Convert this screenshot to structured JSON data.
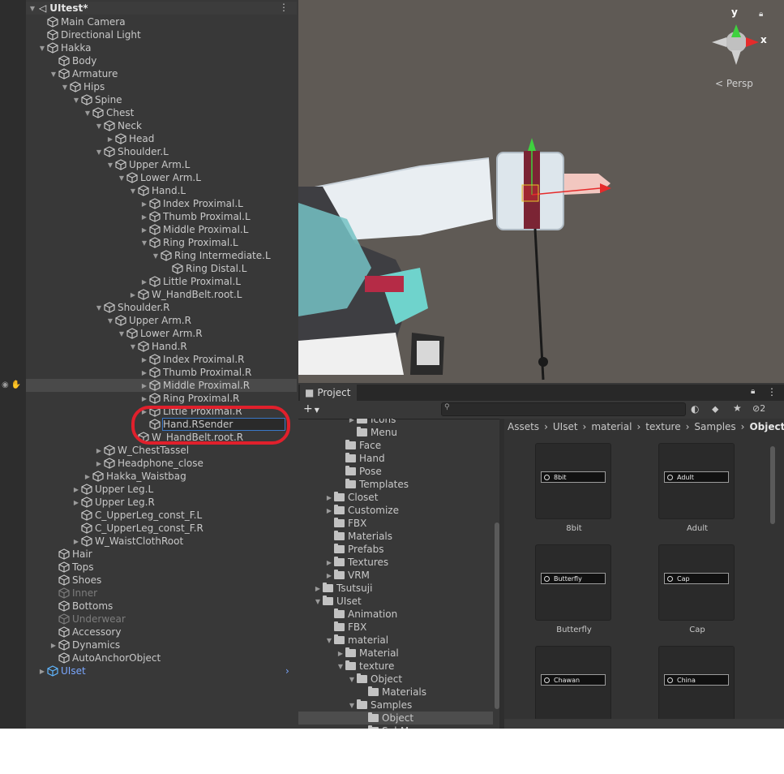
{
  "hierarchy": {
    "scene_title": "UItest*",
    "rows": [
      {
        "label": "Main Camera",
        "indent": 0,
        "arrow": "",
        "style": "normal"
      },
      {
        "label": "Directional Light",
        "indent": 0,
        "arrow": "",
        "style": "normal"
      },
      {
        "label": "Hakka",
        "indent": 0,
        "arrow": "down",
        "style": "normal"
      },
      {
        "label": "Body",
        "indent": 1,
        "arrow": "",
        "style": "normal"
      },
      {
        "label": "Armature",
        "indent": 1,
        "arrow": "down",
        "style": "normal"
      },
      {
        "label": "Hips",
        "indent": 2,
        "arrow": "down",
        "style": "normal"
      },
      {
        "label": "Spine",
        "indent": 3,
        "arrow": "down",
        "style": "normal"
      },
      {
        "label": "Chest",
        "indent": 4,
        "arrow": "down",
        "style": "normal"
      },
      {
        "label": "Neck",
        "indent": 5,
        "arrow": "down",
        "style": "normal"
      },
      {
        "label": "Head",
        "indent": 6,
        "arrow": "right",
        "style": "normal"
      },
      {
        "label": "Shoulder.L",
        "indent": 5,
        "arrow": "down",
        "style": "normal"
      },
      {
        "label": "Upper Arm.L",
        "indent": 6,
        "arrow": "down",
        "style": "normal"
      },
      {
        "label": "Lower Arm.L",
        "indent": 7,
        "arrow": "down",
        "style": "normal"
      },
      {
        "label": "Hand.L",
        "indent": 8,
        "arrow": "down",
        "style": "normal"
      },
      {
        "label": "Index Proximal.L",
        "indent": 9,
        "arrow": "right",
        "style": "normal"
      },
      {
        "label": "Thumb Proximal.L",
        "indent": 9,
        "arrow": "right",
        "style": "normal"
      },
      {
        "label": "Middle Proximal.L",
        "indent": 9,
        "arrow": "right",
        "style": "normal"
      },
      {
        "label": "Ring Proximal.L",
        "indent": 9,
        "arrow": "down",
        "style": "normal"
      },
      {
        "label": "Ring Intermediate.L",
        "indent": 10,
        "arrow": "down",
        "style": "normal"
      },
      {
        "label": "Ring Distal.L",
        "indent": 11,
        "arrow": "",
        "style": "normal"
      },
      {
        "label": "Little Proximal.L",
        "indent": 9,
        "arrow": "right",
        "style": "normal"
      },
      {
        "label": "W_HandBelt.root.L",
        "indent": 8,
        "arrow": "right",
        "style": "normal"
      },
      {
        "label": "Shoulder.R",
        "indent": 5,
        "arrow": "down",
        "style": "normal"
      },
      {
        "label": "Upper Arm.R",
        "indent": 6,
        "arrow": "down",
        "style": "normal"
      },
      {
        "label": "Lower Arm.R",
        "indent": 7,
        "arrow": "down",
        "style": "normal"
      },
      {
        "label": "Hand.R",
        "indent": 8,
        "arrow": "down",
        "style": "normal"
      },
      {
        "label": "Index Proximal.R",
        "indent": 9,
        "arrow": "right",
        "style": "normal"
      },
      {
        "label": "Thumb Proximal.R",
        "indent": 9,
        "arrow": "right",
        "style": "normal"
      },
      {
        "label": "Middle Proximal.R",
        "indent": 9,
        "arrow": "right",
        "style": "hover"
      },
      {
        "label": "Ring Proximal.R",
        "indent": 9,
        "arrow": "right",
        "style": "normal"
      },
      {
        "label": "Little Proximal.R",
        "indent": 9,
        "arrow": "right",
        "style": "normal"
      },
      {
        "label": "Hand.RSender",
        "indent": 9,
        "arrow": "",
        "style": "rename"
      },
      {
        "label": "W_HandBelt.root.R",
        "indent": 8,
        "arrow": "",
        "style": "normal"
      },
      {
        "label": "W_ChestTassel",
        "indent": 5,
        "arrow": "right",
        "style": "normal"
      },
      {
        "label": "Headphone_close",
        "indent": 5,
        "arrow": "right",
        "style": "normal"
      },
      {
        "label": "Hakka_Waistbag",
        "indent": 4,
        "arrow": "right",
        "style": "normal"
      },
      {
        "label": "Upper Leg.L",
        "indent": 3,
        "arrow": "right",
        "style": "normal"
      },
      {
        "label": "Upper Leg.R",
        "indent": 3,
        "arrow": "right",
        "style": "normal"
      },
      {
        "label": "C_UpperLeg_const_F.L",
        "indent": 3,
        "arrow": "",
        "style": "normal"
      },
      {
        "label": "C_UpperLeg_const_F.R",
        "indent": 3,
        "arrow": "",
        "style": "normal"
      },
      {
        "label": "W_WaistClothRoot",
        "indent": 3,
        "arrow": "right",
        "style": "normal"
      },
      {
        "label": "Hair",
        "indent": 1,
        "arrow": "",
        "style": "normal"
      },
      {
        "label": "Tops",
        "indent": 1,
        "arrow": "",
        "style": "normal"
      },
      {
        "label": "Shoes",
        "indent": 1,
        "arrow": "",
        "style": "normal"
      },
      {
        "label": "Inner",
        "indent": 1,
        "arrow": "",
        "style": "dim"
      },
      {
        "label": "Bottoms",
        "indent": 1,
        "arrow": "",
        "style": "normal"
      },
      {
        "label": "Underwear",
        "indent": 1,
        "arrow": "",
        "style": "dim"
      },
      {
        "label": "Accessory",
        "indent": 1,
        "arrow": "",
        "style": "normal"
      },
      {
        "label": "Dynamics",
        "indent": 1,
        "arrow": "right",
        "style": "normal"
      },
      {
        "label": "AutoAnchorObject",
        "indent": 1,
        "arrow": "",
        "style": "normal"
      },
      {
        "label": "UIset",
        "indent": 0,
        "arrow": "right",
        "style": "selected"
      }
    ]
  },
  "scene_view": {
    "gizmo_axes": [
      "y",
      "x"
    ],
    "projection_label": "Persp",
    "colors": {
      "background": "#5f5a55",
      "x_axis": "#e52b2b",
      "y_axis": "#3fd13f",
      "z_axis": "#2b6ee5"
    }
  },
  "project": {
    "tab_label": "Project",
    "hidden_count": "2",
    "breadcrumb": [
      "Assets",
      "UIset",
      "material",
      "texture",
      "Samples",
      "Object"
    ],
    "tree": [
      {
        "label": "Icons",
        "indent": 3,
        "arrow": "right"
      },
      {
        "label": "Menu",
        "indent": 3,
        "arrow": ""
      },
      {
        "label": "Face",
        "indent": 2,
        "arrow": ""
      },
      {
        "label": "Hand",
        "indent": 2,
        "arrow": ""
      },
      {
        "label": "Pose",
        "indent": 2,
        "arrow": ""
      },
      {
        "label": "Templates",
        "indent": 2,
        "arrow": ""
      },
      {
        "label": "Closet",
        "indent": 1,
        "arrow": "right"
      },
      {
        "label": "Customize",
        "indent": 1,
        "arrow": "right"
      },
      {
        "label": "FBX",
        "indent": 1,
        "arrow": ""
      },
      {
        "label": "Materials",
        "indent": 1,
        "arrow": ""
      },
      {
        "label": "Prefabs",
        "indent": 1,
        "arrow": ""
      },
      {
        "label": "Textures",
        "indent": 1,
        "arrow": "right"
      },
      {
        "label": "VRM",
        "indent": 1,
        "arrow": "right"
      },
      {
        "label": "Tsutsuji",
        "indent": 0,
        "arrow": "right"
      },
      {
        "label": "UIset",
        "indent": 0,
        "arrow": "down"
      },
      {
        "label": "Animation",
        "indent": 1,
        "arrow": ""
      },
      {
        "label": "FBX",
        "indent": 1,
        "arrow": ""
      },
      {
        "label": "material",
        "indent": 1,
        "arrow": "down"
      },
      {
        "label": "Material",
        "indent": 2,
        "arrow": "right"
      },
      {
        "label": "texture",
        "indent": 2,
        "arrow": "down"
      },
      {
        "label": "Object",
        "indent": 3,
        "arrow": "down"
      },
      {
        "label": "Materials",
        "indent": 4,
        "arrow": ""
      },
      {
        "label": "Samples",
        "indent": 3,
        "arrow": "down"
      },
      {
        "label": "Object",
        "indent": 4,
        "arrow": "",
        "selected": true
      },
      {
        "label": "SubMenu",
        "indent": 4,
        "arrow": ""
      }
    ],
    "assets": [
      {
        "name": "8bit",
        "chip": "8bit"
      },
      {
        "name": "Adult",
        "chip": "Adult"
      },
      {
        "name": "Butterfly",
        "chip": "Butterfly"
      },
      {
        "name": "Cap",
        "chip": "Cap"
      },
      {
        "name": "",
        "chip": "Chawan"
      },
      {
        "name": "",
        "chip": "China"
      }
    ]
  }
}
